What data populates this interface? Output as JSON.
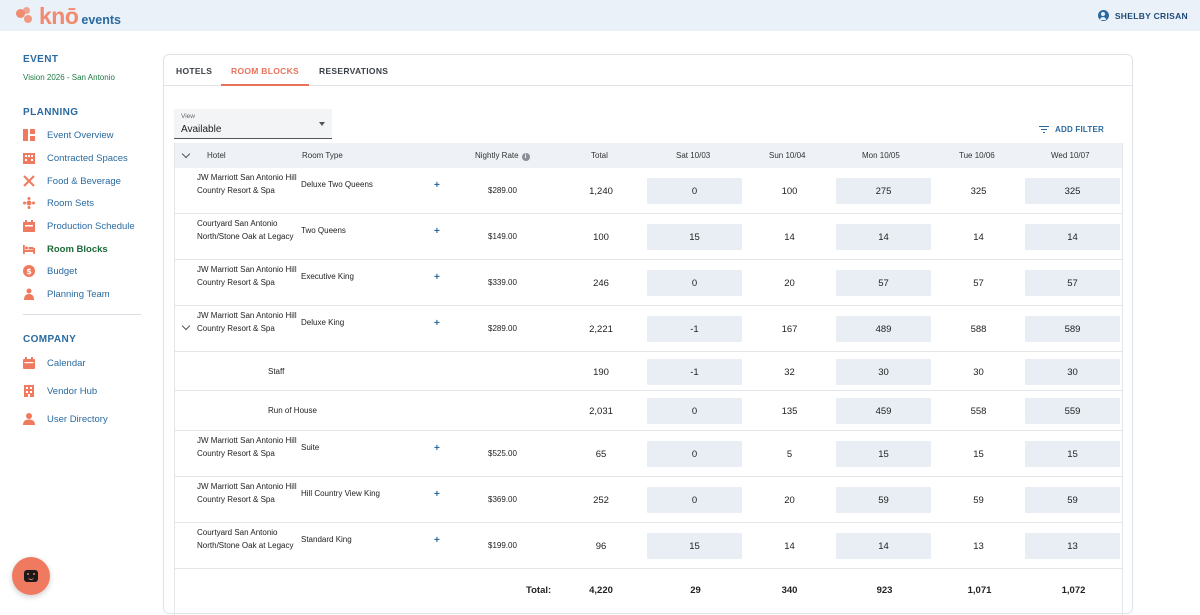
{
  "brand": {
    "logo_text": "knō",
    "logo_suffix": "events",
    "accent": "#f08a70",
    "primary": "#2a6aa0"
  },
  "user": {
    "name": "SHELBY CRISAN",
    "icon": "user-circle-icon"
  },
  "sidebar": {
    "event_title": "EVENT",
    "event_name": "Vision 2026 - San Antonio",
    "planning_title": "PLANNING",
    "planning_items": [
      {
        "label": "Event Overview",
        "icon": "dashboard-icon"
      },
      {
        "label": "Contracted Spaces",
        "icon": "building-icon"
      },
      {
        "label": "Food & Beverage",
        "icon": "utensils-icon"
      },
      {
        "label": "Room Sets",
        "icon": "room-set-icon"
      },
      {
        "label": "Production Schedule",
        "icon": "schedule-icon"
      },
      {
        "label": "Room Blocks",
        "icon": "bed-icon",
        "active": true
      },
      {
        "label": "Budget",
        "icon": "dollar-icon"
      },
      {
        "label": "Planning Team",
        "icon": "team-icon"
      }
    ],
    "company_title": "COMPANY",
    "company_items": [
      {
        "label": "Calendar",
        "icon": "calendar-icon"
      },
      {
        "label": "Vendor Hub",
        "icon": "vendor-icon"
      },
      {
        "label": "User Directory",
        "icon": "user-icon"
      }
    ]
  },
  "tabs": [
    "HOTELS",
    "ROOM BLOCKS",
    "RESERVATIONS"
  ],
  "active_tab": "ROOM BLOCKS",
  "view_select": {
    "label": "View",
    "value": "Available"
  },
  "add_filter_label": "ADD FILTER",
  "table": {
    "headers": [
      "Hotel",
      "Room Type",
      "Nightly Rate",
      "Total",
      "Sat 10/03",
      "Sun 10/04",
      "Mon 10/05",
      "Tue 10/06",
      "Wed 10/07"
    ],
    "rows": [
      {
        "hotel": "JW Marriott San Antonio Hill Country Resort & Spa",
        "room_type": "Deluxe Two Queens",
        "rate": "$289.00",
        "total": "1,240",
        "days": [
          "0",
          "100",
          "275",
          "325",
          "325"
        ]
      },
      {
        "hotel": "Courtyard San Antonio North/Stone Oak at Legacy",
        "room_type": "Two Queens",
        "rate": "$149.00",
        "total": "100",
        "days": [
          "15",
          "14",
          "14",
          "14",
          "14"
        ]
      },
      {
        "hotel": "JW Marriott San Antonio Hill Country Resort & Spa",
        "room_type": "Executive King",
        "rate": "$339.00",
        "total": "246",
        "days": [
          "0",
          "20",
          "57",
          "57",
          "57"
        ]
      },
      {
        "hotel": "JW Marriott San Antonio Hill Country Resort & Spa",
        "room_type": "Deluxe King",
        "rate": "$289.00",
        "total": "2,221",
        "days": [
          "-1",
          "167",
          "489",
          "588",
          "589"
        ],
        "expanded": true
      },
      {
        "sub": true,
        "label": "Staff",
        "total": "190",
        "days": [
          "-1",
          "32",
          "30",
          "30",
          "30"
        ]
      },
      {
        "sub": true,
        "label": "Run of House",
        "total": "2,031",
        "days": [
          "0",
          "135",
          "459",
          "558",
          "559"
        ]
      },
      {
        "hotel": "JW Marriott San Antonio Hill Country Resort & Spa",
        "room_type": "Suite",
        "rate": "$525.00",
        "total": "65",
        "days": [
          "0",
          "5",
          "15",
          "15",
          "15"
        ]
      },
      {
        "hotel": "JW Marriott San Antonio Hill Country Resort & Spa",
        "room_type": "Hill Country View King",
        "rate": "$369.00",
        "total": "252",
        "days": [
          "0",
          "20",
          "59",
          "59",
          "59"
        ]
      },
      {
        "hotel": "Courtyard San Antonio North/Stone Oak at Legacy",
        "room_type": "Standard King",
        "rate": "$199.00",
        "total": "96",
        "days": [
          "15",
          "14",
          "14",
          "13",
          "13"
        ]
      }
    ],
    "totals": {
      "label": "Total:",
      "total": "4,220",
      "days": [
        "29",
        "340",
        "923",
        "1,071",
        "1,072"
      ]
    }
  }
}
